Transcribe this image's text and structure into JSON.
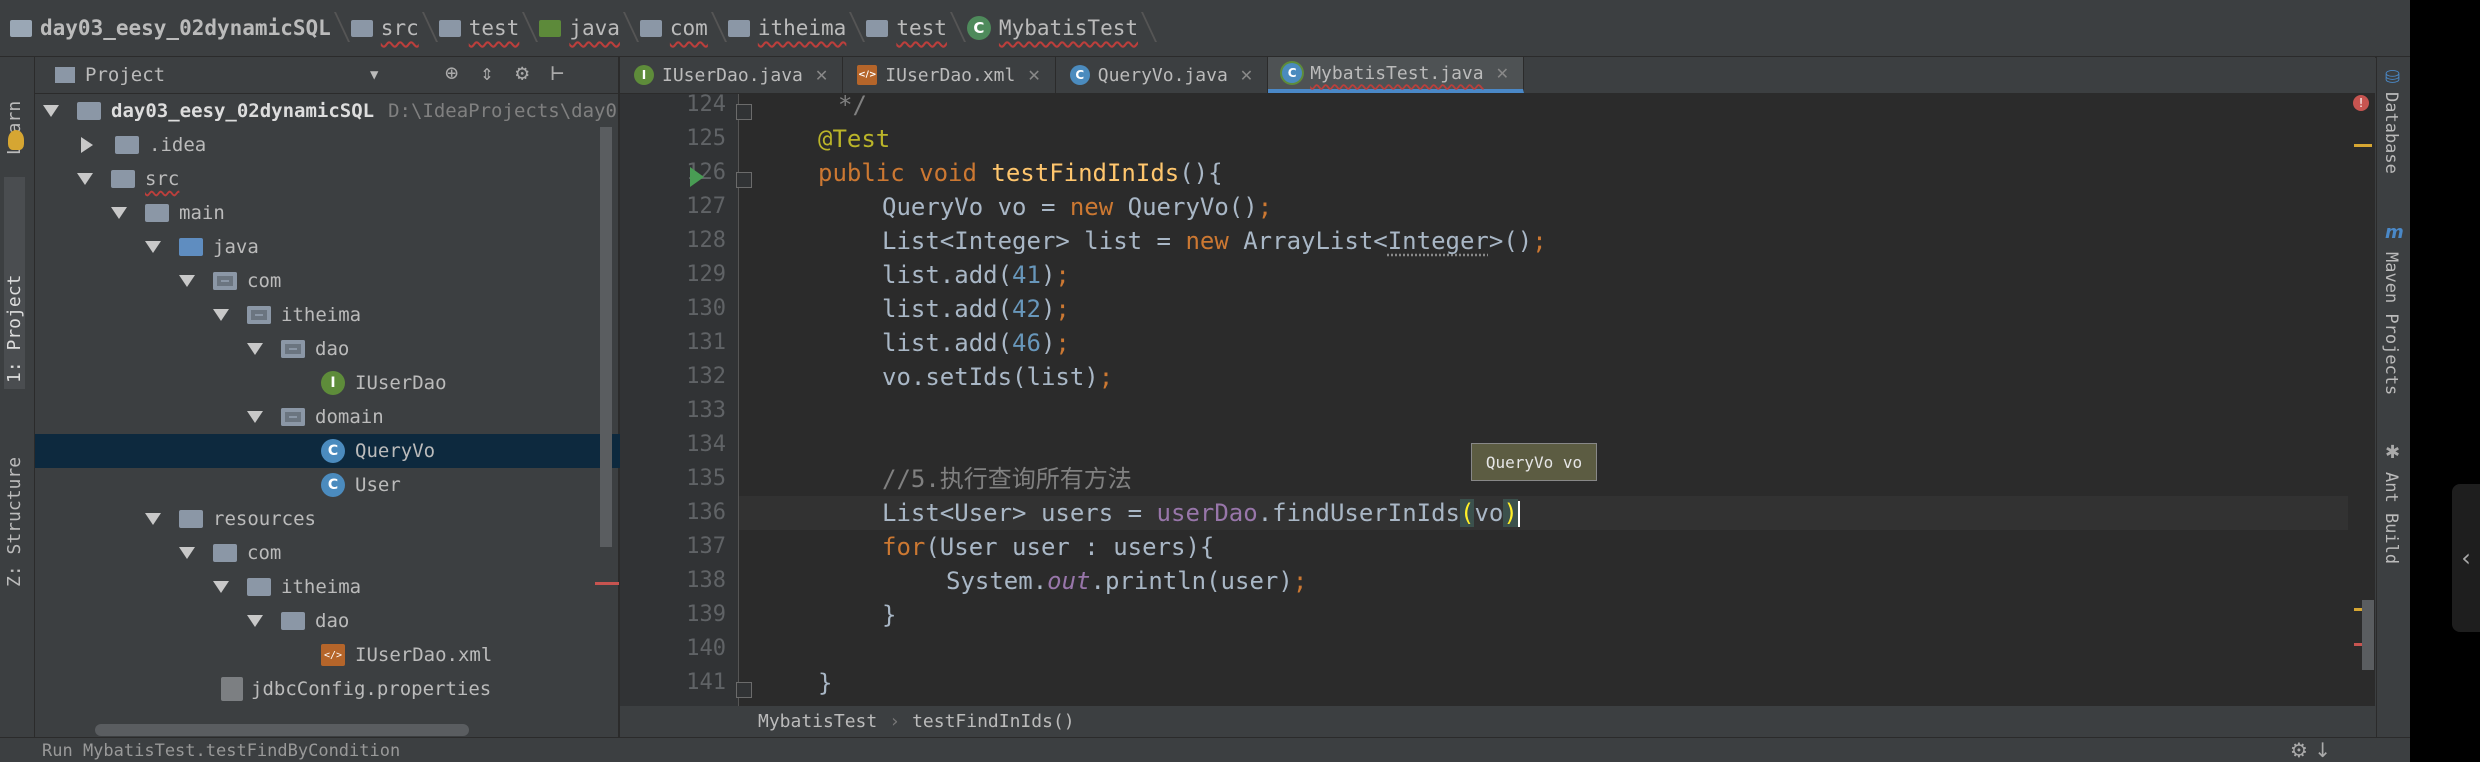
{
  "breadcrumb": {
    "items": [
      "day03_eesy_02dynamicSQL",
      "src",
      "test",
      "java",
      "com",
      "itheima",
      "test",
      "MybatisTest"
    ]
  },
  "left_strip": {
    "learn": "Learn",
    "project": "1: Project",
    "structure": "Z: Structure"
  },
  "project_panel": {
    "title": "Project",
    "tree": [
      {
        "label": "day03_eesy_02dynamicSQL",
        "path": "D:\\IdeaProjects\\day0"
      },
      {
        "label": ".idea"
      },
      {
        "label": "src"
      },
      {
        "label": "main"
      },
      {
        "label": "java"
      },
      {
        "label": "com"
      },
      {
        "label": "itheima"
      },
      {
        "label": "dao"
      },
      {
        "label": "IUserDao"
      },
      {
        "label": "domain"
      },
      {
        "label": "QueryVo"
      },
      {
        "label": "User"
      },
      {
        "label": "resources"
      },
      {
        "label": "com"
      },
      {
        "label": "itheima"
      },
      {
        "label": "dao"
      },
      {
        "label": "IUserDao.xml"
      },
      {
        "label": "jdbcConfig.properties"
      }
    ]
  },
  "tabs": [
    {
      "label": "IUserDao.java",
      "icon": "I"
    },
    {
      "label": "IUserDao.xml",
      "icon": "xml"
    },
    {
      "label": "QueryVo.java",
      "icon": "C"
    },
    {
      "label": "MybatisTest.java",
      "icon": "C"
    }
  ],
  "editor": {
    "line_numbers": [
      "124",
      "125",
      "126",
      "127",
      "128",
      "129",
      "130",
      "131",
      "132",
      "133",
      "134",
      "135",
      "136",
      "137",
      "138",
      "139",
      "140",
      "141"
    ],
    "tooltip": "QueryVo vo"
  },
  "editor_breadcrumb": {
    "class": "MybatisTest",
    "method": "testFindInIds()"
  },
  "right_strip": {
    "database": "Database",
    "maven": "Maven Projects",
    "ant": "Ant Build"
  },
  "statusbar": {
    "run": "Run   MybatisTest.testFindByCondition"
  },
  "colors": {
    "background": "#2b2b2b",
    "keyword": "#cc7832",
    "number": "#6897bb",
    "function": "#ffc66d",
    "annotation": "#bbb529",
    "selection": "#0d293e",
    "active_tab": "#4a88c7"
  }
}
